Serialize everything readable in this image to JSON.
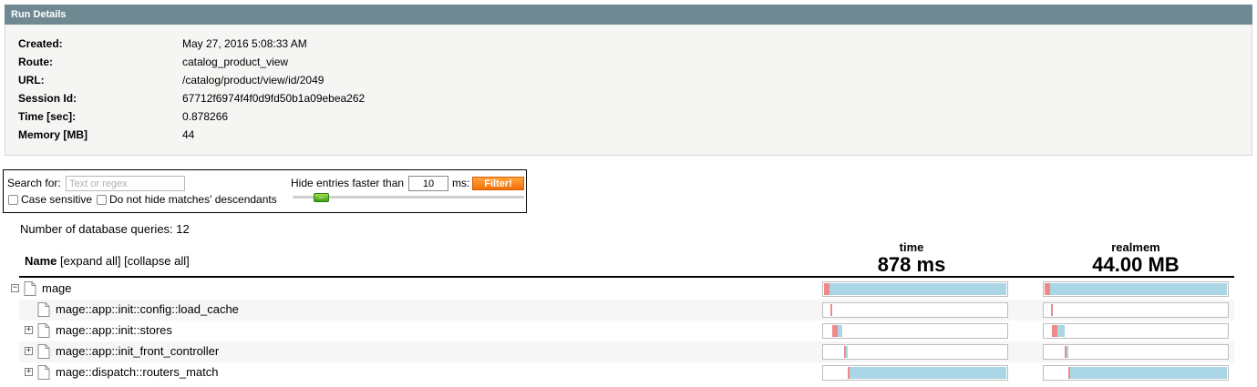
{
  "run_details": {
    "title": "Run Details",
    "rows": [
      {
        "label": "Created:",
        "value": "May 27, 2016 5:08:33 AM"
      },
      {
        "label": "Route:",
        "value": "catalog_product_view"
      },
      {
        "label": "URL:",
        "value": "/catalog/product/view/id/2049"
      },
      {
        "label": "Session Id:",
        "value": "67712f6974f4f0d9fd50b1a09ebea262"
      },
      {
        "label": "Time [sec]:",
        "value": "0.878266"
      },
      {
        "label": "Memory [MB]",
        "value": "44"
      }
    ]
  },
  "filter": {
    "search_label": "Search for:",
    "search_placeholder": "Text or regex",
    "case_sensitive_label": "Case sensitive",
    "no_hide_label": "Do not hide matches' descendants",
    "hide_label": "Hide entries faster than",
    "ms_value": "10",
    "ms_label": "ms:",
    "filter_button": "Filter!",
    "slider_glyph": "⇔"
  },
  "db_queries": "Number of database queries: 12",
  "table": {
    "name_header": "Name",
    "expand_all": "[expand all]",
    "collapse_all": "[collapse all]",
    "metrics": [
      {
        "title": "time",
        "total": "878 ms"
      },
      {
        "title": "realmem",
        "total": "44.00 MB"
      }
    ]
  },
  "tree": [
    {
      "label": "mage",
      "depth": 0,
      "toggle": "−",
      "time": {
        "start": 0.0,
        "own": 0.03,
        "total": 1.0
      },
      "mem": {
        "start": 0.0,
        "own": 0.03,
        "total": 1.0
      }
    },
    {
      "label": "mage::app::init::config::load_cache",
      "depth": 1,
      "toggle": "",
      "time": {
        "start": 0.035,
        "own": 0.01,
        "total": 0.01
      },
      "mem": {
        "start": 0.035,
        "own": 0.01,
        "total": 0.01
      }
    },
    {
      "label": "mage::app::init::stores",
      "depth": 1,
      "toggle": "+",
      "time": {
        "start": 0.045,
        "own": 0.03,
        "total": 0.055
      },
      "mem": {
        "start": 0.04,
        "own": 0.03,
        "total": 0.07
      }
    },
    {
      "label": "mage::app::init_front_controller",
      "depth": 1,
      "toggle": "+",
      "time": {
        "start": 0.11,
        "own": 0.01,
        "total": 0.02
      },
      "mem": {
        "start": 0.11,
        "own": 0.01,
        "total": 0.02
      }
    },
    {
      "label": "mage::dispatch::routers_match",
      "depth": 1,
      "toggle": "+",
      "time": {
        "start": 0.13,
        "own": 0.01,
        "total": 0.87
      },
      "mem": {
        "start": 0.13,
        "own": 0.01,
        "total": 0.87
      }
    }
  ]
}
